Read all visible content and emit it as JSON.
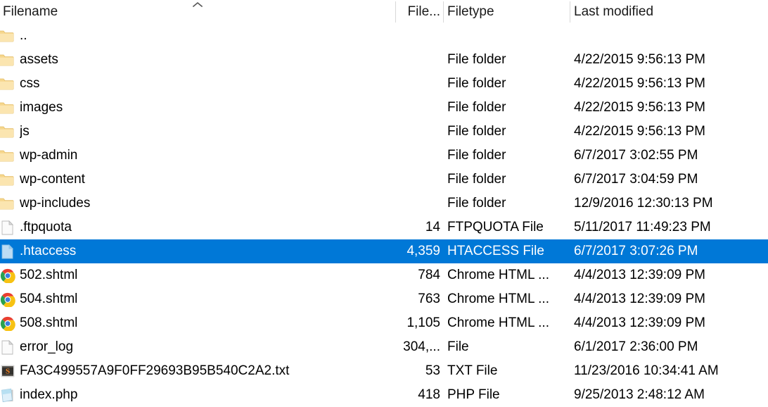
{
  "window": {
    "kind": "file-listing",
    "accent_color": "#0078d7",
    "selected_text_color": "#ffffff",
    "background_color": "#ffffff",
    "divider_color": "#d8d8d8"
  },
  "header": {
    "columns": [
      {
        "key": "filename",
        "label": "Filename",
        "sorted": true,
        "sort_direction": "ascending"
      },
      {
        "key": "filesize",
        "label": "File...",
        "sorted": false
      },
      {
        "key": "filetype",
        "label": "Filetype",
        "sorted": false
      },
      {
        "key": "modified",
        "label": "Last modified",
        "sorted": false
      }
    ],
    "sort_indicator": "chevron-up-icon"
  },
  "rows": [
    {
      "name": "..",
      "size": "",
      "type": "",
      "modified": "",
      "icon": "folder-icon",
      "selected": false
    },
    {
      "name": "assets",
      "size": "",
      "type": "File folder",
      "modified": "4/22/2015 9:56:13 PM",
      "icon": "folder-icon",
      "selected": false
    },
    {
      "name": "css",
      "size": "",
      "type": "File folder",
      "modified": "4/22/2015 9:56:13 PM",
      "icon": "folder-icon",
      "selected": false
    },
    {
      "name": "images",
      "size": "",
      "type": "File folder",
      "modified": "4/22/2015 9:56:13 PM",
      "icon": "folder-icon",
      "selected": false
    },
    {
      "name": "js",
      "size": "",
      "type": "File folder",
      "modified": "4/22/2015 9:56:13 PM",
      "icon": "folder-icon",
      "selected": false
    },
    {
      "name": "wp-admin",
      "size": "",
      "type": "File folder",
      "modified": "6/7/2017 3:02:55 PM",
      "icon": "folder-icon",
      "selected": false
    },
    {
      "name": "wp-content",
      "size": "",
      "type": "File folder",
      "modified": "6/7/2017 3:04:59 PM",
      "icon": "folder-icon",
      "selected": false
    },
    {
      "name": "wp-includes",
      "size": "",
      "type": "File folder",
      "modified": "12/9/2016 12:30:13 PM",
      "icon": "folder-icon",
      "selected": false
    },
    {
      "name": ".ftpquota",
      "size": "14",
      "type": "FTPQUOTA File",
      "modified": "5/11/2017 11:49:23 PM",
      "icon": "generic-file-icon",
      "selected": false
    },
    {
      "name": ".htaccess",
      "size": "4,359",
      "type": "HTACCESS File",
      "modified": "6/7/2017 3:07:26 PM",
      "icon": "generic-file-icon",
      "selected": true
    },
    {
      "name": "502.shtml",
      "size": "784",
      "type": "Chrome HTML ...",
      "modified": "4/4/2013 12:39:09 PM",
      "icon": "chrome-icon",
      "selected": false
    },
    {
      "name": "504.shtml",
      "size": "763",
      "type": "Chrome HTML ...",
      "modified": "4/4/2013 12:39:09 PM",
      "icon": "chrome-icon",
      "selected": false
    },
    {
      "name": "508.shtml",
      "size": "1,105",
      "type": "Chrome HTML ...",
      "modified": "4/4/2013 12:39:09 PM",
      "icon": "chrome-icon",
      "selected": false
    },
    {
      "name": "error_log",
      "size": "304,...",
      "type": "File",
      "modified": "6/1/2017 2:36:00 PM",
      "icon": "generic-file-icon",
      "selected": false
    },
    {
      "name": "FA3C499557A9F0FF29693B95B540C2A2.txt",
      "size": "53",
      "type": "TXT File",
      "modified": "11/23/2016 10:34:41 AM",
      "icon": "sublime-text-icon",
      "selected": false
    },
    {
      "name": "index.php",
      "size": "418",
      "type": "PHP File",
      "modified": "9/25/2013 2:48:12 AM",
      "icon": "php-file-icon",
      "selected": false
    }
  ]
}
